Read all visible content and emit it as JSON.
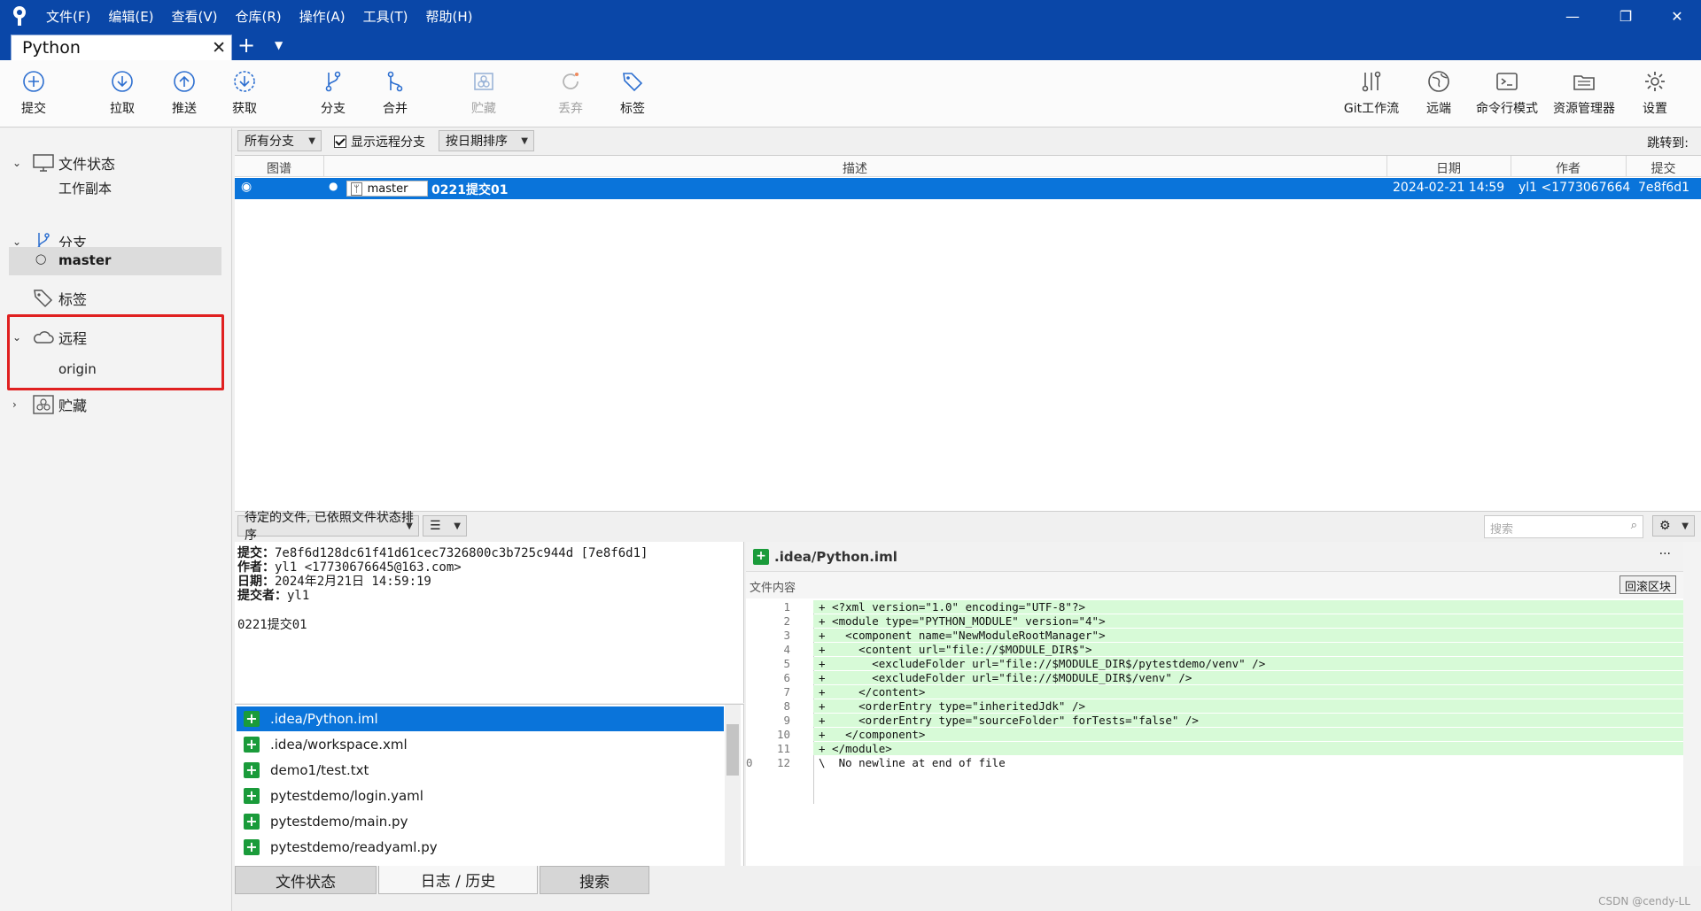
{
  "menu": [
    "文件(F)",
    "编辑(E)",
    "查看(V)",
    "仓库(R)",
    "操作(A)",
    "工具(T)",
    "帮助(H)"
  ],
  "tab": {
    "title": "Python",
    "close": "✕",
    "add": "+",
    "more": "▼"
  },
  "toolbar": {
    "commit": "提交",
    "pull": "拉取",
    "push": "推送",
    "fetch": "获取",
    "branch": "分支",
    "merge": "合并",
    "stash": "贮藏",
    "discard": "丢弃",
    "tag": "标签",
    "git_flow": "Git工作流",
    "remote": "远端",
    "terminal": "命令行模式",
    "explorer": "资源管理器",
    "settings": "设置"
  },
  "sidebar": {
    "file_status": "文件状态",
    "working_copy": "工作副本",
    "branches": "分支",
    "master": "master",
    "tags": "标签",
    "remotes": "远程",
    "origin": "origin",
    "stashes": "贮藏"
  },
  "filter": {
    "branches": "所有分支",
    "show_remote": "显示远程分支",
    "sort": "按日期排序",
    "jump_to": "跳转到:"
  },
  "columns": {
    "graph": "图谱",
    "description": "描述",
    "date": "日期",
    "author": "作者",
    "commit": "提交"
  },
  "commit": {
    "branch": "master",
    "message": "0221提交01",
    "date": "2024-02-21 14:59",
    "author": "yl1 <1773067664",
    "hash": "7e8f6d1"
  },
  "lower": {
    "pending_sort": "待定的文件, 已依照文件状态排序",
    "search_placeholder": "搜索"
  },
  "details": {
    "commit_label": "提交：",
    "commit_value": "7e8f6d128dc61f41d61cec7326800c3b725c944d [7e8f6d1]",
    "author_label": "作者：",
    "author_value": "yl1 <17730676645@163.com>",
    "date_label": "日期：",
    "date_value": "2024年2月21日 14:59:19",
    "committer_label": "提交者：",
    "committer_value": "yl1",
    "message": "0221提交01"
  },
  "files": [
    ".idea/Python.iml",
    ".idea/workspace.xml",
    "demo1/test.txt",
    "pytestdemo/login.yaml",
    "pytestdemo/main.py",
    "pytestdemo/readyaml.py"
  ],
  "diff": {
    "file": ".idea/Python.iml",
    "section": "文件内容",
    "revert": "回滚区块",
    "more": "···",
    "lines": [
      {
        "old": "",
        "new": "1",
        "text": "+ <?xml version=\"1.0\" encoding=\"UTF-8\"?>"
      },
      {
        "old": "",
        "new": "2",
        "text": "+ <module type=\"PYTHON_MODULE\" version=\"4\">"
      },
      {
        "old": "",
        "new": "3",
        "text": "+   <component name=\"NewModuleRootManager\">"
      },
      {
        "old": "",
        "new": "4",
        "text": "+     <content url=\"file://$MODULE_DIR$\">"
      },
      {
        "old": "",
        "new": "5",
        "text": "+       <excludeFolder url=\"file://$MODULE_DIR$/pytestdemo/venv\" />"
      },
      {
        "old": "",
        "new": "6",
        "text": "+       <excludeFolder url=\"file://$MODULE_DIR$/venv\" />"
      },
      {
        "old": "",
        "new": "7",
        "text": "+     </content>"
      },
      {
        "old": "",
        "new": "8",
        "text": "+     <orderEntry type=\"inheritedJdk\" />"
      },
      {
        "old": "",
        "new": "9",
        "text": "+     <orderEntry type=\"sourceFolder\" forTests=\"false\" />"
      },
      {
        "old": "",
        "new": "10",
        "text": "+   </component>"
      },
      {
        "old": "",
        "new": "11",
        "text": "+ </module>"
      },
      {
        "old": "0",
        "new": "12",
        "text": "\\  No newline at end of file"
      }
    ]
  },
  "bottom_tabs": {
    "file_status": "文件状态",
    "log": "日志 / 历史",
    "search": "搜索"
  },
  "watermark": "CSDN @cendy-LL",
  "colors": {
    "titlebar": "#0a47a8",
    "selection": "#0a74da",
    "added_line": "#d7fad7",
    "highlight_box": "#e02020"
  }
}
